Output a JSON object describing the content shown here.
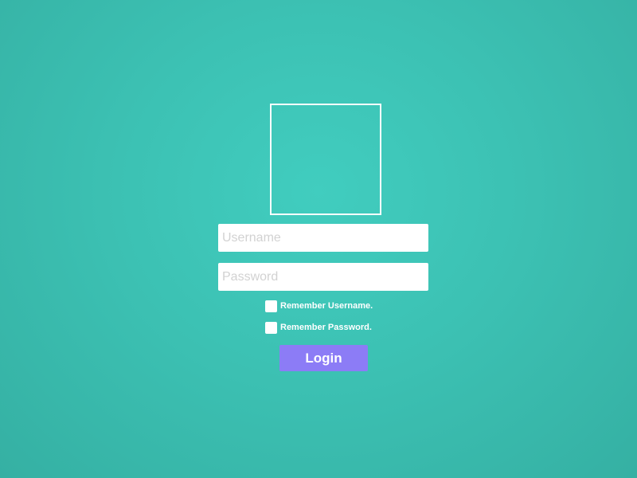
{
  "login_form": {
    "username_placeholder": "Username",
    "password_placeholder": "Password",
    "username_value": "",
    "password_value": "",
    "remember_username_label": "Remember Username.",
    "remember_password_label": "Remember Password.",
    "remember_username_checked": false,
    "remember_password_checked": false,
    "login_label": "Login"
  },
  "colors": {
    "background": "#3cc1b3",
    "button": "#8c7cf6",
    "field_background": "#ffffff",
    "text": "#ffffff"
  }
}
